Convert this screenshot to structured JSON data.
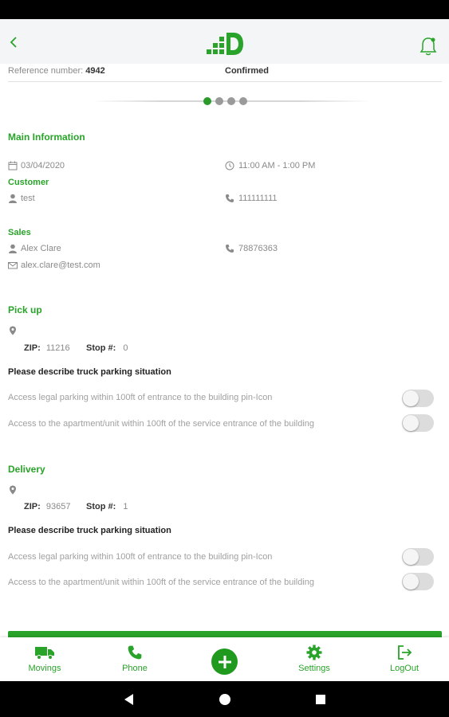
{
  "colors": {
    "accent": "#29a329",
    "header_bg": "#f3f5f7",
    "muted_text": "#8a8a8a"
  },
  "header": {
    "back_icon": "chevron-left-icon",
    "logo_icon": "company-logo",
    "bell_icon": "bell-icon"
  },
  "job": {
    "reference_label": "Reference number:",
    "reference_value": "4942",
    "status": "Confirmed"
  },
  "pager": {
    "total": 4,
    "active_index": 0
  },
  "main_info": {
    "title": "Main Information",
    "date": "03/04/2020",
    "time": "11:00 AM - 1:00 PM",
    "customer_label": "Customer",
    "customer_name": "test",
    "customer_phone": "111111111",
    "sales_label": "Sales",
    "sales_name": "Alex Clare",
    "sales_phone": "78876363",
    "sales_email": "alex.clare@test.com"
  },
  "pickup": {
    "title": "Pick up",
    "zip_label": "ZIP:",
    "zip_value": "11216",
    "stop_label": "Stop #:",
    "stop_value": "0",
    "parking_title": "Please describe truck parking situation",
    "option1": "Access legal parking within 100ft of entrance to the building pin-Icon",
    "option2": "Access to the apartment/unit within 100ft of the service entrance of the building",
    "option1_on": false,
    "option2_on": false
  },
  "delivery": {
    "title": "Delivery",
    "zip_label": "ZIP:",
    "zip_value": "93657",
    "stop_label": "Stop #:",
    "stop_value": "1",
    "parking_title": "Please describe truck parking situation",
    "option1": "Access legal parking within 100ft of entrance to the building pin-Icon",
    "option2": "Access to the apartment/unit within 100ft of the service entrance of the building",
    "option1_on": false,
    "option2_on": false
  },
  "tabs": {
    "movings": "Movings",
    "phone": "Phone",
    "settings": "Settings",
    "logout": "LogOut"
  }
}
